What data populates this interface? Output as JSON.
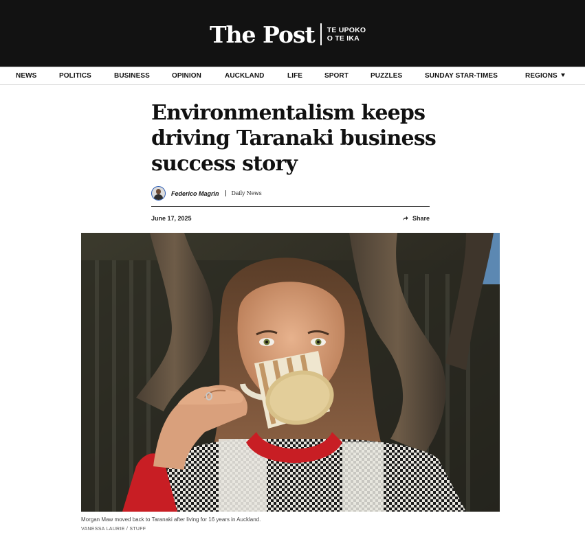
{
  "masthead": {
    "logo_main": "The Post",
    "logo_sub_line1": "TE UPOKO",
    "logo_sub_line2": "O TE IKA"
  },
  "nav": {
    "items": [
      "NEWS",
      "POLITICS",
      "BUSINESS",
      "OPINION",
      "AUCKLAND",
      "LIFE",
      "SPORT",
      "PUZZLES",
      "SUNDAY STAR-TIMES",
      "REGIONS"
    ]
  },
  "article": {
    "headline_lines": [
      "Environmentalism keeps",
      "driving Taranaki business",
      "success story"
    ],
    "author": "Federico Magrin",
    "publication": "Daily News",
    "date": "June 17, 2025",
    "share_label": "Share"
  },
  "photo": {
    "caption": "Morgan Maw moved back to Taranaki after living for 16 years in Auckland.",
    "credit": "VANESSA LAURIE / STUFF"
  }
}
